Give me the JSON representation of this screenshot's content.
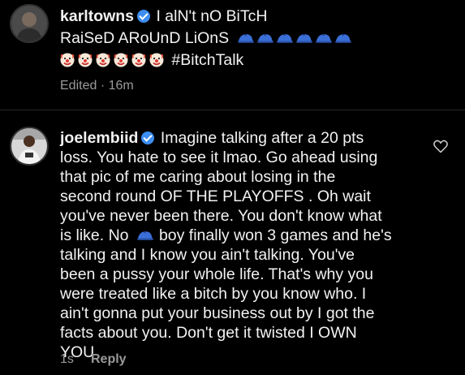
{
  "comment1": {
    "username": "karltowns",
    "line1": "I alN't nO BiTcH",
    "line2": "RaiSeD ARoUnD LiOnS",
    "hashtag": "#BitchTalk",
    "edited": "Edited · 16m",
    "icons": {
      "verified": "verified-badge-icon",
      "cap": "blue-cap-emoji",
      "clown": "clown-face-emoji"
    },
    "cap_count": 6,
    "clown_count": 6
  },
  "comment2": {
    "username": "joelembiid",
    "line1": "Imagine talking after a 20 pts",
    "lines": [
      "loss. You hate to see it lmao. Go ahead using",
      "that pic of me caring about losing in the",
      "second round OF THE PLAYOFFS . Oh wait",
      "you've never been there. You don't know what",
      "is like. No",
      "boy finally won 3 games and he's",
      "talking and I know you ain't talking. You've",
      "been a pussy your whole life. That's why you",
      "were treated like a bitch by you know who. I",
      "ain't gonna put your business out by I got the",
      "facts about you. Don't get it twisted I OWN",
      "YOU"
    ],
    "time": "1s",
    "reply": "Reply"
  },
  "colors": {
    "background": "#000000",
    "text": "#f2f2f2",
    "meta": "#9a9a9a",
    "verified": "#3d8ef0"
  }
}
